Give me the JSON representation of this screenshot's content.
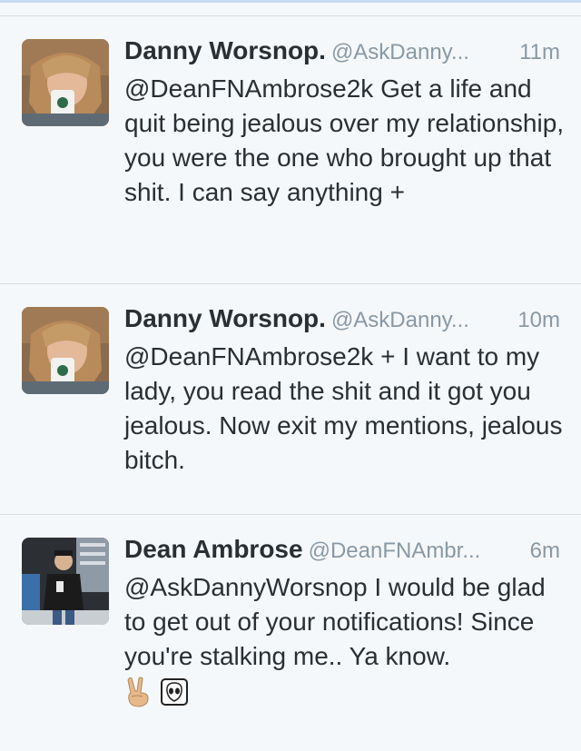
{
  "tweets": [
    {
      "name": "Danny Worsnop.",
      "handle": "@AskDanny...",
      "time": "11m",
      "text": "@DeanFNAmbrose2k Get a life and quit being jealous over my relationship, you were the one who brought up that shit. I can say anything +",
      "avatar": "avatar-danny"
    },
    {
      "name": "Danny Worsnop.",
      "handle": "@AskDanny...",
      "time": "10m",
      "text": "@DeanFNAmbrose2k + I want to my lady, you read the shit and it got you jealous. Now exit my mentions, jealous bitch.",
      "avatar": "avatar-danny"
    },
    {
      "name": "Dean Ambrose",
      "handle": "@DeanFNAmbr...",
      "time": "6m",
      "text": "@AskDannyWorsnop I would be glad to get out of your notifications! Since you're stalking me.. Ya know.",
      "avatar": "avatar-dean",
      "emojis": [
        "victory-hand-icon",
        "alien-icon"
      ]
    }
  ]
}
